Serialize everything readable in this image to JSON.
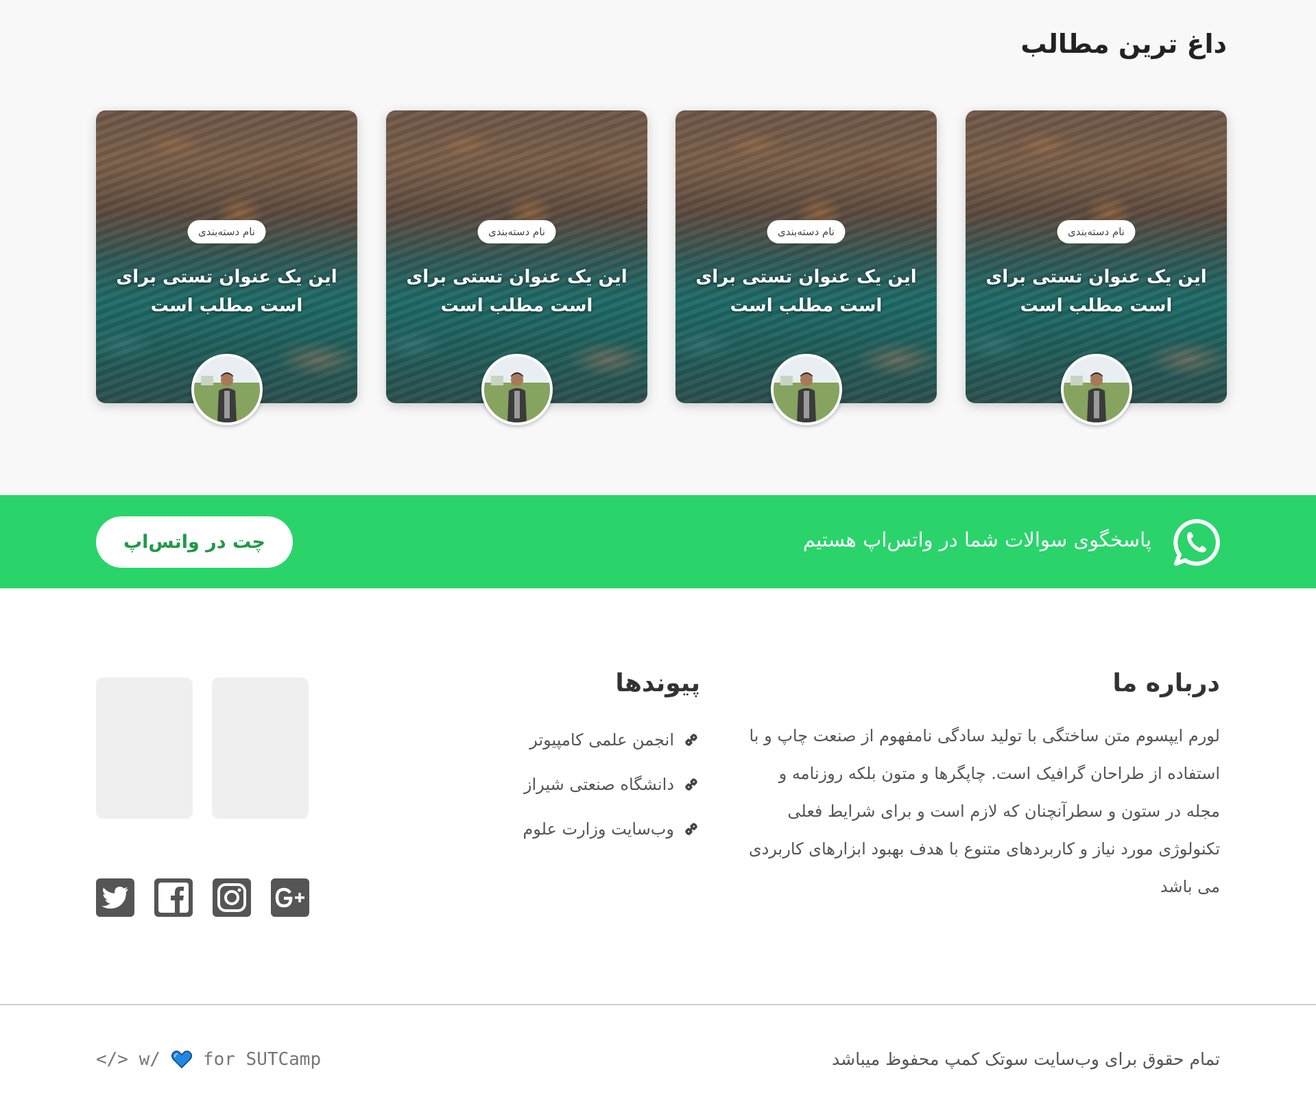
{
  "hot_section": {
    "title": "داغ ترین مطالب",
    "cards": [
      {
        "category": "نام دسته‌بندی",
        "title": "این یک عنوان تستی برای است مطلب است"
      },
      {
        "category": "نام دسته‌بندی",
        "title": "این یک عنوان تستی برای است مطلب است"
      },
      {
        "category": "نام دسته‌بندی",
        "title": "این یک عنوان تستی برای است مطلب است"
      },
      {
        "category": "نام دسته‌بندی",
        "title": "این یک عنوان تستی برای است مطلب است"
      }
    ]
  },
  "whatsapp": {
    "text": "پاسخگوی سوالات شما در واتس‌اپ هستیم",
    "button_label": "چت در واتس‌اپ",
    "color": "#2ad46a"
  },
  "footer": {
    "about": {
      "title": "درباره ما",
      "text": "لورم ایپسوم متن ساختگی با تولید سادگی نامفهوم از صنعت چاپ و با استفاده از طراحان گرافیک است. چاپگرها و متون بلکه روزنامه و مجله در ستون و سطرآنچنان که لازم است و برای شرایط فعلی تکنولوژی مورد نیاز و کاربردهای متنوع با هدف بهبود ابزارهای کاربردی می باشد"
    },
    "links": {
      "title": "پیوندها",
      "items": [
        "انجمن علمی کامپیوتر",
        "دانشگاه صنعتی شیراز",
        "وب‌سایت وزارت علوم"
      ]
    },
    "social_icons": [
      "twitter-icon",
      "facebook-icon",
      "instagram-icon",
      "google-plus-icon"
    ],
    "copyright": "تمام حقوق برای وب‌سایت سوتک کمپ محفوظ میباشد",
    "credit": {
      "code": "</> w/",
      "suffix": "for SUTCamp",
      "heart_color": "#1e88e5"
    }
  }
}
